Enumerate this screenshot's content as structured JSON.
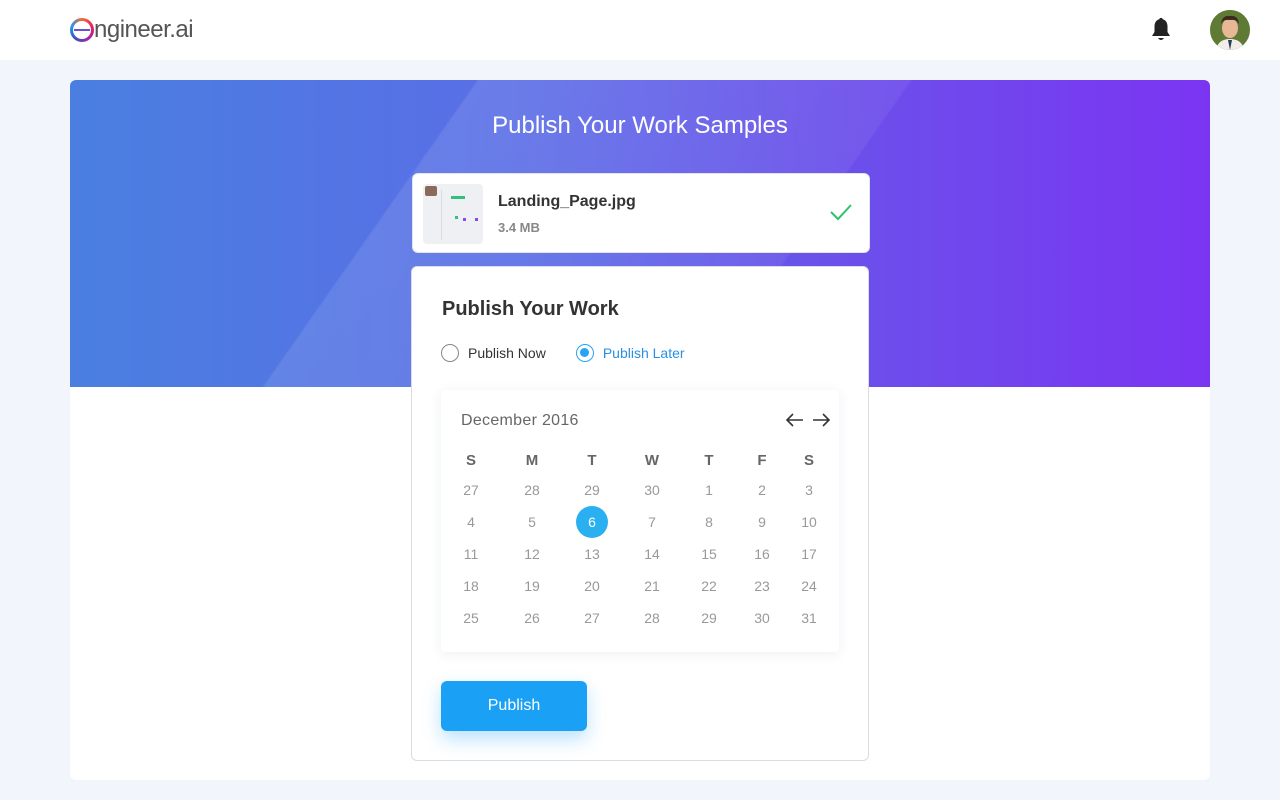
{
  "header": {
    "logo_text": "ngineer.ai",
    "notifications_icon": "bell-icon",
    "avatar_icon": "user-avatar"
  },
  "hero": {
    "title": "Publish Your Work Samples"
  },
  "file": {
    "name": "Landing_Page.jpg",
    "size": "3.4 MB",
    "status_icon": "check-icon",
    "status_color": "#2bc26b"
  },
  "publish": {
    "title": "Publish Your Work",
    "options": [
      {
        "label": "Publish Now",
        "selected": false
      },
      {
        "label": "Publish Later",
        "selected": true
      }
    ],
    "button_label": "Publish",
    "accent_color": "#1aa0f5"
  },
  "calendar": {
    "month": "December 2016",
    "weekdays": [
      "S",
      "M",
      "T",
      "W",
      "T",
      "F",
      "S"
    ],
    "weeks": [
      [
        "27",
        "28",
        "29",
        "30",
        "1",
        "2",
        "3"
      ],
      [
        "4",
        "5",
        "6",
        "7",
        "8",
        "9",
        "10"
      ],
      [
        "11",
        "12",
        "13",
        "14",
        "15",
        "16",
        "17"
      ],
      [
        "18",
        "19",
        "20",
        "21",
        "22",
        "23",
        "24"
      ],
      [
        "25",
        "26",
        "27",
        "28",
        "29",
        "30",
        "31"
      ]
    ],
    "selected_day": "6",
    "prev_icon": "arrow-left-icon",
    "next_icon": "arrow-right-icon"
  }
}
